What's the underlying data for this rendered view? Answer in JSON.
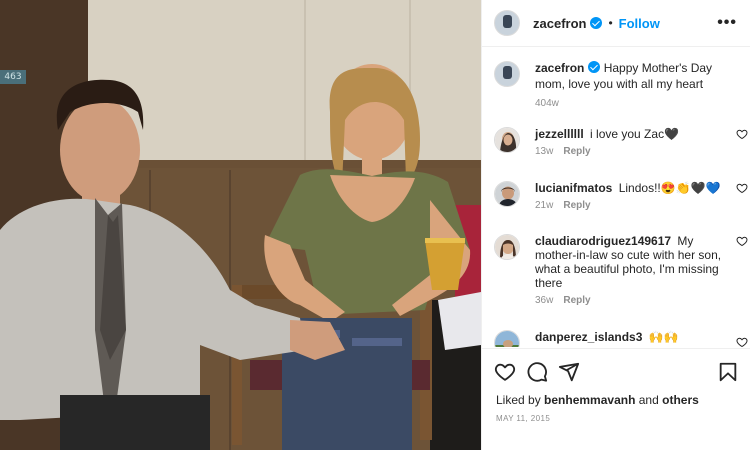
{
  "post": {
    "author": "zacefron",
    "follow_label": "Follow",
    "separator": "•",
    "more_label": "•••",
    "photo_tag": "463",
    "caption": {
      "author": "zacefron",
      "text": "Happy Mother's Day mom, love you with all my heart",
      "age": "404w"
    },
    "comments": [
      {
        "user": "jezzellllll",
        "text": "i love you Zac🖤",
        "age": "13w",
        "reply": "Reply"
      },
      {
        "user": "lucianifmatos",
        "text": "Lindos!!😍👏🖤💙",
        "age": "21w",
        "reply": "Reply"
      },
      {
        "user": "claudiarodriguez149617",
        "text": "My mother-in-law so cute with her son, what a beautiful photo, I'm missing there",
        "age": "36w",
        "reply": "Reply"
      },
      {
        "user": "danperez_islands3",
        "text": "🙌🙌",
        "age": "",
        "reply": ""
      }
    ],
    "likes": {
      "prefix": "Liked by",
      "user": "benhemmavanh",
      "connector": "and",
      "others": "others"
    },
    "date": "MAY 11, 2015"
  },
  "icons": {
    "verified": "verified-badge-icon",
    "more": "more-options-icon",
    "like": "heart-icon",
    "comment": "comment-icon",
    "share": "share-icon",
    "save": "bookmark-icon"
  },
  "colors": {
    "accent": "#0095f6",
    "muted": "#8e8e8e",
    "text": "#262626",
    "border": "#efefef"
  }
}
